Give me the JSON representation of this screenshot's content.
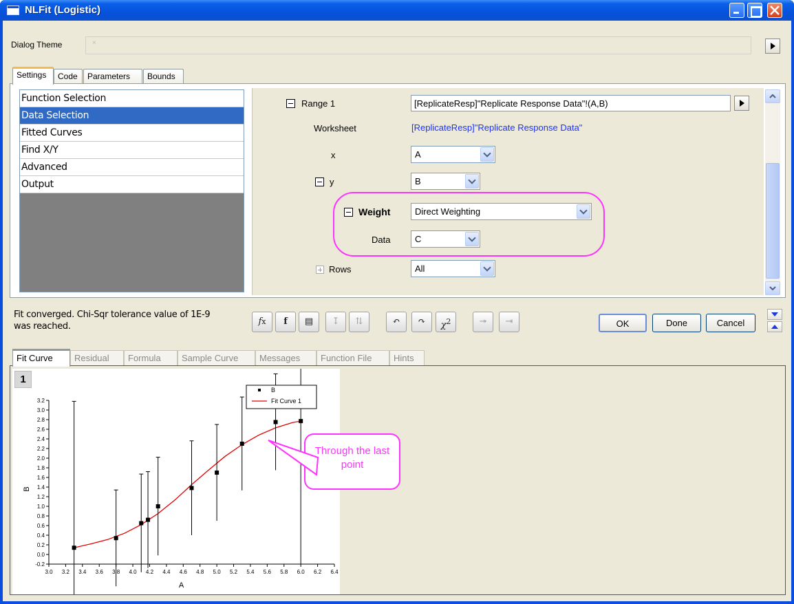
{
  "window": {
    "title": "NLFit (Logistic)",
    "dialog_theme_label": "Dialog Theme",
    "dialog_theme_value": "×"
  },
  "settings_tabs": [
    "Settings",
    "Code",
    "Parameters",
    "Bounds"
  ],
  "nav_list": [
    "Function Selection",
    "Data Selection",
    "Fitted Curves",
    "Find X/Y",
    "Advanced",
    "Output"
  ],
  "props": {
    "range_label": "Range 1",
    "range_value": "[ReplicateResp]\"Replicate Response Data\"!(A,B)",
    "worksheet_label": "Worksheet",
    "worksheet_value": "[ReplicateResp]\"Replicate Response Data\"",
    "x_label": "x",
    "x_value": "A",
    "y_label": "y",
    "y_value": "B",
    "weight_label": "Weight",
    "weight_value": "Direct Weighting",
    "data_label": "Data",
    "data_value": "C",
    "rows_label": "Rows",
    "rows_value": "All"
  },
  "status": {
    "message": "Fit converged. Chi-Sqr tolerance value of 1E-9 was reached."
  },
  "buttons": {
    "ok": "OK",
    "done": "Done",
    "cancel": "Cancel"
  },
  "result_tabs": [
    "Fit Curve",
    "Residual",
    "Formula",
    "Sample Curve",
    "Messages",
    "Function File",
    "Hints"
  ],
  "graph": {
    "layer": "1",
    "callout": "Through the last point",
    "highlight_color": "#ff33ff",
    "curve_color": "#e00000"
  },
  "chart_data": {
    "type": "scatter",
    "xlabel": "A",
    "ylabel": "B",
    "xlim": [
      3.0,
      6.4
    ],
    "ylim": [
      -0.2,
      3.2
    ],
    "x_ticks": [
      "3.0",
      "3.2",
      "3.4",
      "3.6",
      "3.8",
      "4.0",
      "4.2",
      "4.4",
      "4.6",
      "4.8",
      "5.0",
      "5.2",
      "5.4",
      "5.6",
      "5.8",
      "6.0",
      "6.2",
      "6.4"
    ],
    "y_ticks": [
      "-0.2",
      "0.0",
      "0.2",
      "0.4",
      "0.6",
      "0.8",
      "1.0",
      "1.2",
      "1.4",
      "1.6",
      "1.8",
      "2.0",
      "2.2",
      "2.4",
      "2.6",
      "2.8",
      "3.0",
      "3.2"
    ],
    "legend": [
      "B",
      "Fit Curve 1"
    ],
    "series": [
      {
        "name": "B",
        "x": [
          3.3,
          3.8,
          4.1,
          4.18,
          4.3,
          4.7,
          5.0,
          5.3,
          5.7,
          6.0
        ],
        "y": [
          0.14,
          0.34,
          0.65,
          0.72,
          1.0,
          1.38,
          1.7,
          2.3,
          2.75,
          2.77
        ],
        "err": [
          3.04,
          1.0,
          1.02,
          1.0,
          1.02,
          0.98,
          1.0,
          0.97,
          1.0,
          2.97
        ]
      },
      {
        "name": "Fit Curve 1",
        "x": [
          3.3,
          3.5,
          3.7,
          3.9,
          4.1,
          4.3,
          4.5,
          4.7,
          4.9,
          5.1,
          5.3,
          5.5,
          5.7,
          5.9,
          6.0
        ],
        "y": [
          0.14,
          0.22,
          0.31,
          0.44,
          0.62,
          0.85,
          1.13,
          1.45,
          1.75,
          2.04,
          2.28,
          2.48,
          2.63,
          2.74,
          2.77
        ]
      }
    ]
  }
}
